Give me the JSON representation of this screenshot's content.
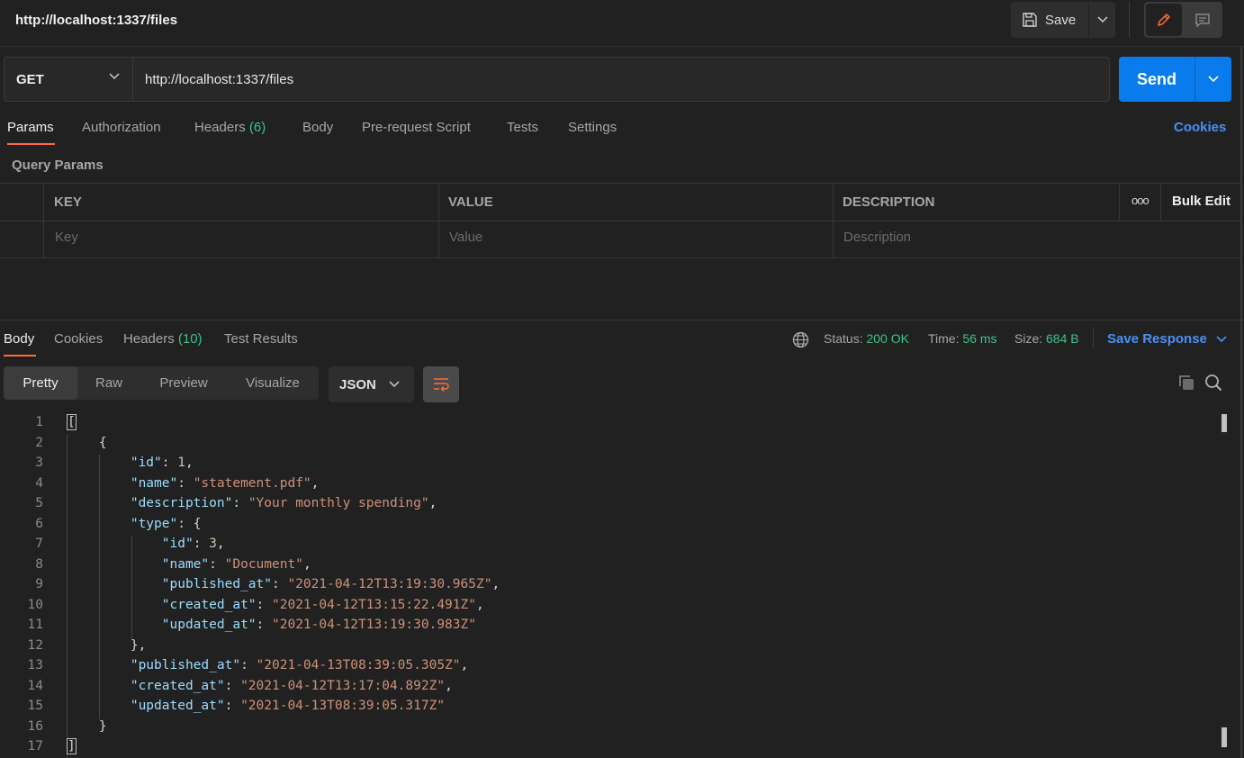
{
  "top": {
    "title": "http://localhost:1337/files",
    "save_label": "Save"
  },
  "request": {
    "method": "GET",
    "url": "http://localhost:1337/files",
    "send_label": "Send"
  },
  "req_tabs": {
    "params": "Params",
    "authorization": "Authorization",
    "headers": "Headers",
    "headers_count": "(6)",
    "body": "Body",
    "prerequest": "Pre-request Script",
    "tests": "Tests",
    "settings": "Settings",
    "cookies": "Cookies"
  },
  "params": {
    "section_label": "Query Params",
    "columns": {
      "key": "KEY",
      "value": "VALUE",
      "description": "DESCRIPTION"
    },
    "more": "ooo",
    "bulk_edit": "Bulk Edit",
    "placeholders": {
      "key": "Key",
      "value": "Value",
      "description": "Description"
    }
  },
  "response": {
    "tabs": {
      "body": "Body",
      "cookies": "Cookies",
      "headers": "Headers",
      "headers_count": "(10)",
      "test_results": "Test Results"
    },
    "status_label": "Status:",
    "status_value": "200 OK",
    "time_label": "Time:",
    "time_value": "56 ms",
    "size_label": "Size:",
    "size_value": "684 B",
    "save_response": "Save Response",
    "views": {
      "pretty": "Pretty",
      "raw": "Raw",
      "preview": "Preview",
      "visualize": "Visualize"
    },
    "format": "JSON"
  },
  "code_lines": [
    {
      "n": "1"
    },
    {
      "n": "2"
    },
    {
      "n": "3"
    },
    {
      "n": "4"
    },
    {
      "n": "5"
    },
    {
      "n": "6"
    },
    {
      "n": "7"
    },
    {
      "n": "8"
    },
    {
      "n": "9"
    },
    {
      "n": "10"
    },
    {
      "n": "11"
    },
    {
      "n": "12"
    },
    {
      "n": "13"
    },
    {
      "n": "14"
    },
    {
      "n": "15"
    },
    {
      "n": "16"
    },
    {
      "n": "17"
    }
  ],
  "json": {
    "id_key": "\"id\"",
    "id_val": "1",
    "name_key": "\"name\"",
    "name_val": "\"statement.pdf\"",
    "desc_key": "\"description\"",
    "desc_val": "\"Your monthly spending\"",
    "type_key": "\"type\"",
    "t_id_key": "\"id\"",
    "t_id_val": "3",
    "t_name_key": "\"name\"",
    "t_name_val": "\"Document\"",
    "t_pub_key": "\"published_at\"",
    "t_pub_val": "\"2021-04-12T13:19:30.965Z\"",
    "t_cre_key": "\"created_at\"",
    "t_cre_val": "\"2021-04-12T13:15:22.491Z\"",
    "t_upd_key": "\"updated_at\"",
    "t_upd_val": "\"2021-04-12T13:19:30.983Z\"",
    "pub_key": "\"published_at\"",
    "pub_val": "\"2021-04-13T08:39:05.305Z\"",
    "cre_key": "\"created_at\"",
    "cre_val": "\"2021-04-12T13:17:04.892Z\"",
    "upd_key": "\"updated_at\"",
    "upd_val": "\"2021-04-13T08:39:05.317Z\""
  }
}
